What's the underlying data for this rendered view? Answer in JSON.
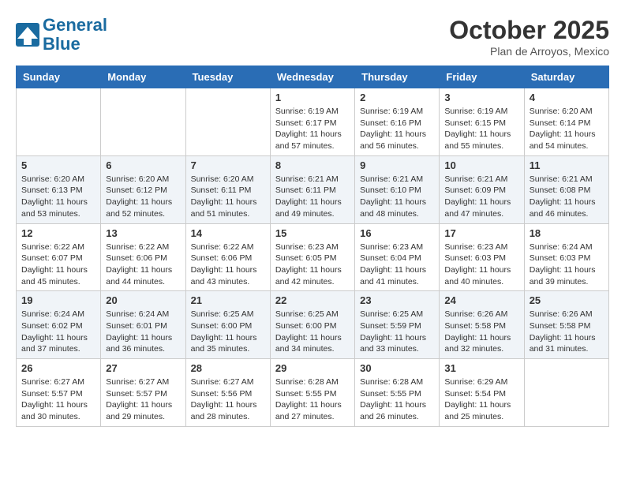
{
  "header": {
    "logo_line1": "General",
    "logo_line2": "Blue",
    "month": "October 2025",
    "location": "Plan de Arroyos, Mexico"
  },
  "weekdays": [
    "Sunday",
    "Monday",
    "Tuesday",
    "Wednesday",
    "Thursday",
    "Friday",
    "Saturday"
  ],
  "weeks": [
    [
      {
        "day": "",
        "info": ""
      },
      {
        "day": "",
        "info": ""
      },
      {
        "day": "",
        "info": ""
      },
      {
        "day": "1",
        "info": "Sunrise: 6:19 AM\nSunset: 6:17 PM\nDaylight: 11 hours and 57 minutes."
      },
      {
        "day": "2",
        "info": "Sunrise: 6:19 AM\nSunset: 6:16 PM\nDaylight: 11 hours and 56 minutes."
      },
      {
        "day": "3",
        "info": "Sunrise: 6:19 AM\nSunset: 6:15 PM\nDaylight: 11 hours and 55 minutes."
      },
      {
        "day": "4",
        "info": "Sunrise: 6:20 AM\nSunset: 6:14 PM\nDaylight: 11 hours and 54 minutes."
      }
    ],
    [
      {
        "day": "5",
        "info": "Sunrise: 6:20 AM\nSunset: 6:13 PM\nDaylight: 11 hours and 53 minutes."
      },
      {
        "day": "6",
        "info": "Sunrise: 6:20 AM\nSunset: 6:12 PM\nDaylight: 11 hours and 52 minutes."
      },
      {
        "day": "7",
        "info": "Sunrise: 6:20 AM\nSunset: 6:11 PM\nDaylight: 11 hours and 51 minutes."
      },
      {
        "day": "8",
        "info": "Sunrise: 6:21 AM\nSunset: 6:11 PM\nDaylight: 11 hours and 49 minutes."
      },
      {
        "day": "9",
        "info": "Sunrise: 6:21 AM\nSunset: 6:10 PM\nDaylight: 11 hours and 48 minutes."
      },
      {
        "day": "10",
        "info": "Sunrise: 6:21 AM\nSunset: 6:09 PM\nDaylight: 11 hours and 47 minutes."
      },
      {
        "day": "11",
        "info": "Sunrise: 6:21 AM\nSunset: 6:08 PM\nDaylight: 11 hours and 46 minutes."
      }
    ],
    [
      {
        "day": "12",
        "info": "Sunrise: 6:22 AM\nSunset: 6:07 PM\nDaylight: 11 hours and 45 minutes."
      },
      {
        "day": "13",
        "info": "Sunrise: 6:22 AM\nSunset: 6:06 PM\nDaylight: 11 hours and 44 minutes."
      },
      {
        "day": "14",
        "info": "Sunrise: 6:22 AM\nSunset: 6:06 PM\nDaylight: 11 hours and 43 minutes."
      },
      {
        "day": "15",
        "info": "Sunrise: 6:23 AM\nSunset: 6:05 PM\nDaylight: 11 hours and 42 minutes."
      },
      {
        "day": "16",
        "info": "Sunrise: 6:23 AM\nSunset: 6:04 PM\nDaylight: 11 hours and 41 minutes."
      },
      {
        "day": "17",
        "info": "Sunrise: 6:23 AM\nSunset: 6:03 PM\nDaylight: 11 hours and 40 minutes."
      },
      {
        "day": "18",
        "info": "Sunrise: 6:24 AM\nSunset: 6:03 PM\nDaylight: 11 hours and 39 minutes."
      }
    ],
    [
      {
        "day": "19",
        "info": "Sunrise: 6:24 AM\nSunset: 6:02 PM\nDaylight: 11 hours and 37 minutes."
      },
      {
        "day": "20",
        "info": "Sunrise: 6:24 AM\nSunset: 6:01 PM\nDaylight: 11 hours and 36 minutes."
      },
      {
        "day": "21",
        "info": "Sunrise: 6:25 AM\nSunset: 6:00 PM\nDaylight: 11 hours and 35 minutes."
      },
      {
        "day": "22",
        "info": "Sunrise: 6:25 AM\nSunset: 6:00 PM\nDaylight: 11 hours and 34 minutes."
      },
      {
        "day": "23",
        "info": "Sunrise: 6:25 AM\nSunset: 5:59 PM\nDaylight: 11 hours and 33 minutes."
      },
      {
        "day": "24",
        "info": "Sunrise: 6:26 AM\nSunset: 5:58 PM\nDaylight: 11 hours and 32 minutes."
      },
      {
        "day": "25",
        "info": "Sunrise: 6:26 AM\nSunset: 5:58 PM\nDaylight: 11 hours and 31 minutes."
      }
    ],
    [
      {
        "day": "26",
        "info": "Sunrise: 6:27 AM\nSunset: 5:57 PM\nDaylight: 11 hours and 30 minutes."
      },
      {
        "day": "27",
        "info": "Sunrise: 6:27 AM\nSunset: 5:57 PM\nDaylight: 11 hours and 29 minutes."
      },
      {
        "day": "28",
        "info": "Sunrise: 6:27 AM\nSunset: 5:56 PM\nDaylight: 11 hours and 28 minutes."
      },
      {
        "day": "29",
        "info": "Sunrise: 6:28 AM\nSunset: 5:55 PM\nDaylight: 11 hours and 27 minutes."
      },
      {
        "day": "30",
        "info": "Sunrise: 6:28 AM\nSunset: 5:55 PM\nDaylight: 11 hours and 26 minutes."
      },
      {
        "day": "31",
        "info": "Sunrise: 6:29 AM\nSunset: 5:54 PM\nDaylight: 11 hours and 25 minutes."
      },
      {
        "day": "",
        "info": ""
      }
    ]
  ]
}
